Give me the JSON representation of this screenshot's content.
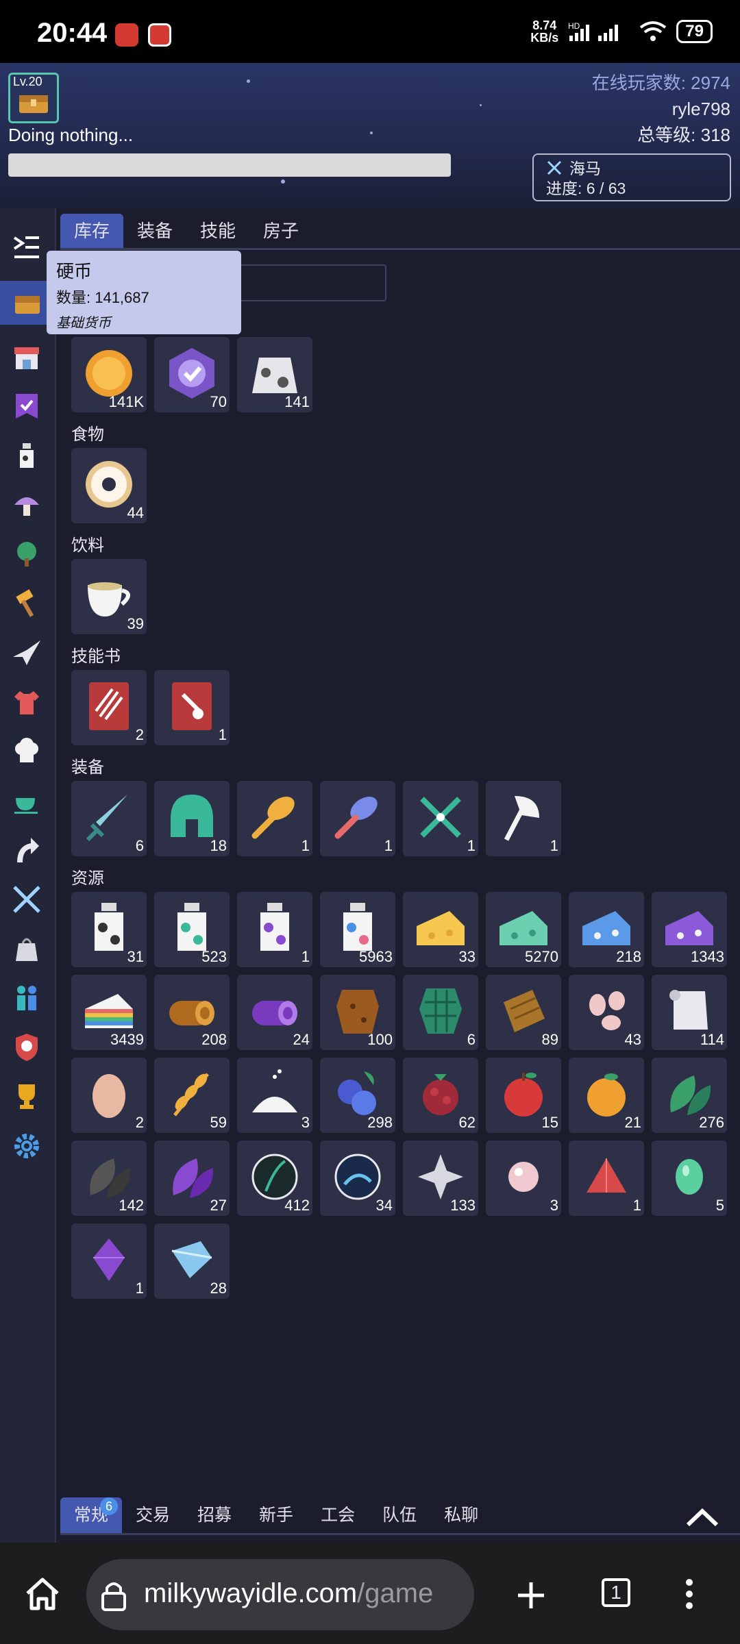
{
  "statusbar": {
    "time": "20:44",
    "speed_top": "8.74",
    "speed_bottom": "KB/s",
    "network": "HD",
    "battery": "79"
  },
  "header": {
    "level": "Lv.20",
    "status": "Doing nothing...",
    "online_label": "在线玩家数: 2974",
    "username": "ryle798",
    "total_level": "总等级: 318",
    "quest_name": "海马",
    "quest_progress": "进度: 6 / 63"
  },
  "tabs": [
    "库存",
    "装备",
    "技能",
    "房子"
  ],
  "tooltip": {
    "title": "硬币",
    "qty": "数量: 141,687",
    "desc": "基础货币"
  },
  "sections": {
    "currency": "",
    "food": "食物",
    "drinks": "饮料",
    "books": "技能书",
    "equipment": "装备",
    "resources": "资源"
  },
  "items": {
    "currency": [
      {
        "icon": "coin-icon",
        "count": "141K"
      },
      {
        "icon": "task-token-icon",
        "count": "70"
      },
      {
        "icon": "cowbell-icon",
        "count": "141"
      }
    ],
    "food": [
      {
        "icon": "donut-icon",
        "count": "44"
      }
    ],
    "drinks": [
      {
        "icon": "tea-cup-icon",
        "count": "39"
      }
    ],
    "books": [
      {
        "icon": "book-claw-icon",
        "count": "2"
      },
      {
        "icon": "book-hammer-icon",
        "count": "1"
      }
    ],
    "equipment": [
      {
        "icon": "sword-icon",
        "count": "6"
      },
      {
        "icon": "helmet-icon",
        "count": "18"
      },
      {
        "icon": "brush-icon",
        "count": "1"
      },
      {
        "icon": "rainbow-brush-icon",
        "count": "1"
      },
      {
        "icon": "shears-icon",
        "count": "1"
      },
      {
        "icon": "axe-icon",
        "count": "1"
      }
    ],
    "resources": [
      {
        "icon": "milk-icon",
        "count": "31"
      },
      {
        "icon": "verdant-milk-icon",
        "count": "523"
      },
      {
        "icon": "purple-milk-icon",
        "count": "1"
      },
      {
        "icon": "azure-milk-icon",
        "count": "5963"
      },
      {
        "icon": "cheese-icon",
        "count": "33"
      },
      {
        "icon": "verdant-cheese-icon",
        "count": "5270"
      },
      {
        "icon": "azure-cheese-icon",
        "count": "218"
      },
      {
        "icon": "amethyst-cheese-icon",
        "count": "1343"
      },
      {
        "icon": "rainbow-cheese-icon",
        "count": "3439"
      },
      {
        "icon": "log-icon",
        "count": "208"
      },
      {
        "icon": "purple-log-icon",
        "count": "24"
      },
      {
        "icon": "leather-icon",
        "count": "100"
      },
      {
        "icon": "green-fabric-icon",
        "count": "6"
      },
      {
        "icon": "fabric-icon",
        "count": "89"
      },
      {
        "icon": "beans-icon",
        "count": "43"
      },
      {
        "icon": "paper-icon",
        "count": "114"
      },
      {
        "icon": "egg-icon",
        "count": "2"
      },
      {
        "icon": "wheat-icon",
        "count": "59"
      },
      {
        "icon": "sugar-icon",
        "count": "3"
      },
      {
        "icon": "blueberry-icon",
        "count": "298"
      },
      {
        "icon": "raspberry-icon",
        "count": "62"
      },
      {
        "icon": "apple-icon",
        "count": "15"
      },
      {
        "icon": "orange-icon",
        "count": "21"
      },
      {
        "icon": "green-tea-leaf-icon",
        "count": "276"
      },
      {
        "icon": "black-tea-leaf-icon",
        "count": "142"
      },
      {
        "icon": "purple-tea-leaf-icon",
        "count": "27"
      },
      {
        "icon": "nature-essence-icon",
        "count": "412"
      },
      {
        "icon": "water-essence-icon",
        "count": "34"
      },
      {
        "icon": "star-fragment-icon",
        "count": "133"
      },
      {
        "icon": "pearl-icon",
        "count": "3"
      },
      {
        "icon": "garnet-icon",
        "count": "1"
      },
      {
        "icon": "jade-icon",
        "count": "5"
      },
      {
        "icon": "amethyst-icon",
        "count": "1"
      },
      {
        "icon": "crystal-icon",
        "count": "28"
      }
    ]
  },
  "chat_tabs": [
    "常规",
    "交易",
    "招募",
    "新手",
    "工会",
    "队伍",
    "私聊"
  ],
  "chat_badge": "6",
  "browser": {
    "domain": "milkywayidle.com",
    "path": "/game",
    "tab_count": "1"
  },
  "colors": {
    "accent": "#4558b0",
    "background": "#1b1d2c",
    "tile": "#2d3046"
  }
}
